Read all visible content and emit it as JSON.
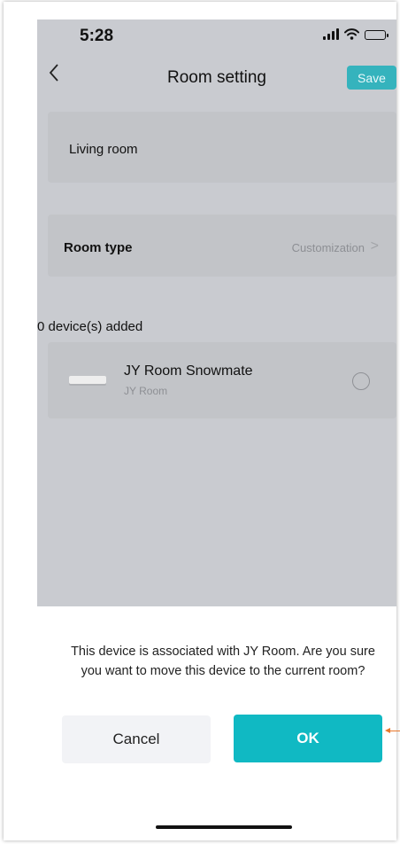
{
  "status_bar": {
    "time": "5:28",
    "icons": [
      "signal-icon",
      "wifi-icon",
      "battery-icon"
    ]
  },
  "nav": {
    "back_icon": "chevron-left-icon",
    "title": "Room setting",
    "save_label": "Save"
  },
  "room": {
    "name": "Living room"
  },
  "room_type": {
    "label": "Room type",
    "value": "Customization"
  },
  "devices": {
    "count_label": "0 device(s) added",
    "items": [
      {
        "name": "JY Room Snowmate",
        "room": "JY Room",
        "selected": false
      }
    ]
  },
  "dialog": {
    "message": "This device is associated with JY Room. Are you sure you want to move this device to the current room?",
    "cancel_label": "Cancel",
    "ok_label": "OK"
  },
  "colors": {
    "accent": "#10b9c3",
    "overlay": "#c9cbd0",
    "annotation_arrow": "#e8782d"
  }
}
